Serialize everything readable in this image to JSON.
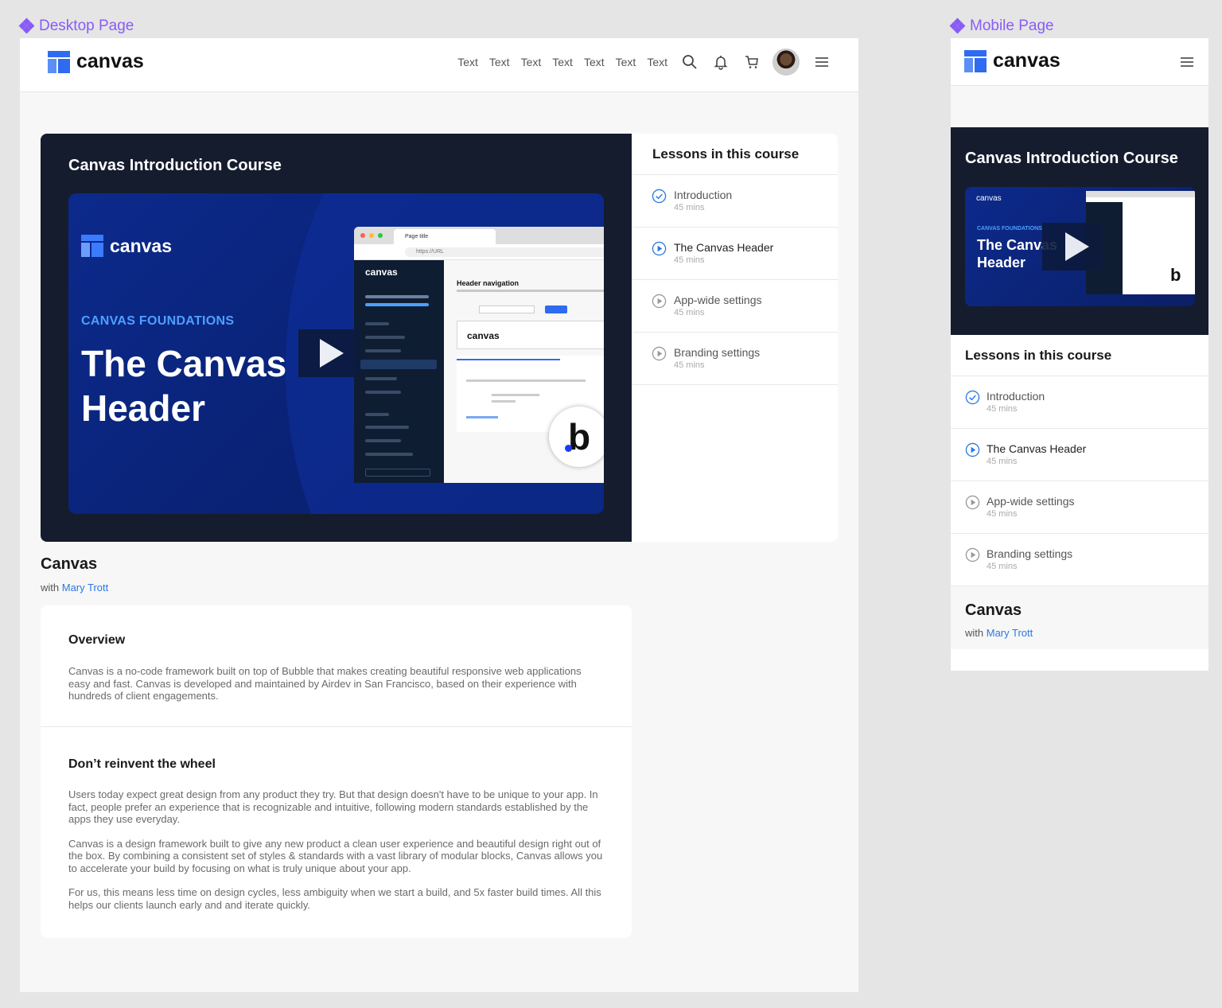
{
  "frames": {
    "desktop_label": "Desktop Page",
    "mobile_label": "Mobile Page",
    "label_color": "#8a5cf6"
  },
  "brand": {
    "name": "canvas",
    "primary_color": "#2f6bf0",
    "link_color": "#2a78e4",
    "dark_panel_color": "#151c2e"
  },
  "header": {
    "nav_links": [
      "Text",
      "Text",
      "Text",
      "Text",
      "Text",
      "Text",
      "Text"
    ],
    "icons": [
      "search-icon",
      "bell-icon",
      "cart-icon",
      "avatar",
      "hamburger-menu-icon"
    ]
  },
  "course": {
    "title": "Canvas Introduction Course",
    "video": {
      "logo_text": "canvas",
      "eyebrow": "CANVAS FOUNDATIONS",
      "headline_line1": "The Canvas",
      "headline_line2": "Header",
      "mock": {
        "tab_title": "Page title",
        "url": "https://URL",
        "sidebar_logo": "canvas",
        "section_title": "Header navigation",
        "card_logo": "canvas"
      },
      "badge_letter": "b"
    },
    "lessons_title": "Lessons in this course",
    "lessons": [
      {
        "name": "Introduction",
        "duration": "45 mins",
        "status": "completed"
      },
      {
        "name": "The Canvas Header",
        "duration": "45 mins",
        "status": "playing"
      },
      {
        "name": "App-wide settings",
        "duration": "45 mins",
        "status": "not-started"
      },
      {
        "name": "Branding settings",
        "duration": "45 mins",
        "status": "not-started"
      }
    ],
    "name": "Canvas",
    "by_prefix": "with",
    "author": "Mary Trott"
  },
  "overview": {
    "title": "Overview",
    "body": "Canvas is a no-code framework built on top of Bubble that makes creating beautiful responsive web applications easy and fast. Canvas is developed and maintained by Airdev in San Francisco, based on their experience with hundreds of client engagements."
  },
  "reinvent": {
    "title": "Don’t reinvent the wheel",
    "paragraphs": [
      "Users today expect great design from any product they try. But that design doesn't have to be unique to your app. In fact, people prefer an experience that is recognizable and intuitive, following modern standards established by the apps they use everyday.",
      "Canvas is a design framework built to give any new product a clean user experience and beautiful design right out of the box. By combining a consistent set of styles & standards with a vast library of modular blocks, Canvas allows you to accelerate your build by focusing on what is truly unique about your app.",
      "For us, this means less time on design cycles, less ambiguity when we start a build, and 5x faster build times. All this helps our clients launch early and and iterate quickly."
    ]
  }
}
